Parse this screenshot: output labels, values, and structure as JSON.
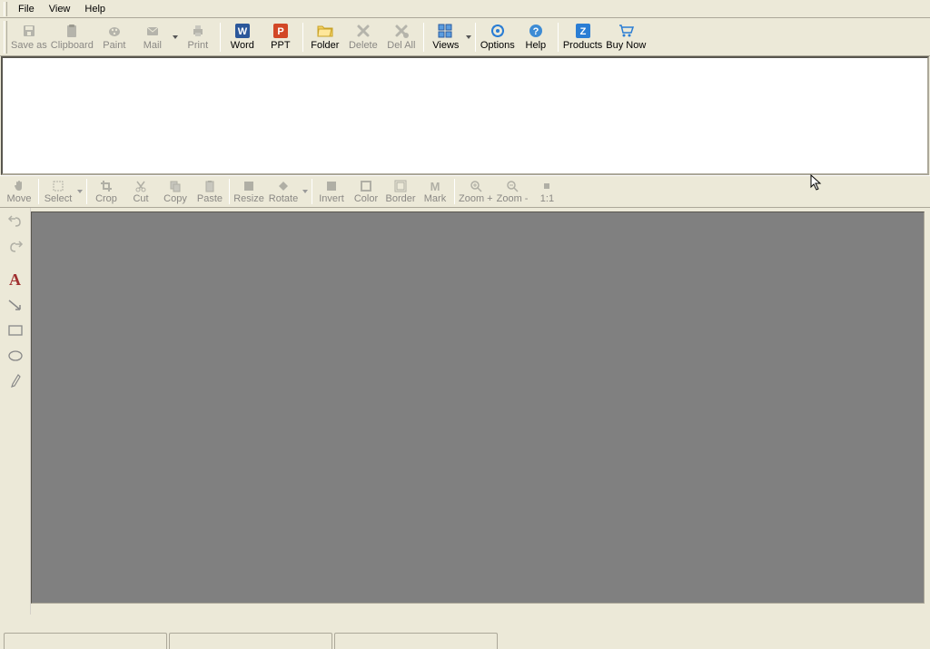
{
  "menu": {
    "file": "File",
    "view": "View",
    "help": "Help"
  },
  "toolbar": {
    "save_as": "Save as",
    "clipboard": "Clipboard",
    "paint": "Paint",
    "mail": "Mail",
    "print": "Print",
    "word": "Word",
    "ppt": "PPT",
    "folder": "Folder",
    "delete": "Delete",
    "del_all": "Del All",
    "views": "Views",
    "options": "Options",
    "help": "Help",
    "products": "Products",
    "buy_now": "Buy Now"
  },
  "editbar": {
    "move": "Move",
    "select": "Select",
    "crop": "Crop",
    "cut": "Cut",
    "copy": "Copy",
    "paste": "Paste",
    "resize": "Resize",
    "rotate": "Rotate",
    "invert": "Invert",
    "color": "Color",
    "border": "Border",
    "mark": "Mark",
    "zoom_in": "Zoom +",
    "zoom_out": "Zoom -",
    "one_to_one": "1:1"
  },
  "sidebar": {
    "undo": "undo",
    "redo": "redo",
    "text": "text",
    "arrow": "arrow",
    "rect": "rectangle",
    "ellipse": "ellipse",
    "pen": "pen"
  }
}
